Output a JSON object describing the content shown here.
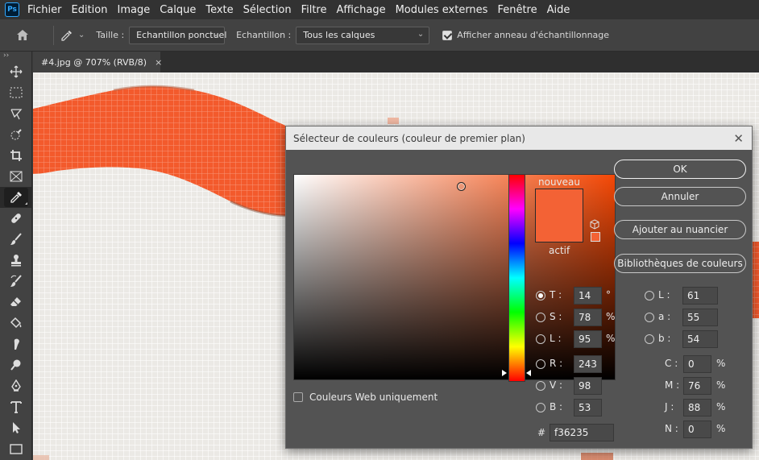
{
  "app": {
    "logo": "Ps"
  },
  "menu": [
    "Fichier",
    "Edition",
    "Image",
    "Calque",
    "Texte",
    "Sélection",
    "Filtre",
    "Affichage",
    "Modules externes",
    "Fenêtre",
    "Aide"
  ],
  "options": {
    "size_label": "Taille :",
    "size_value": "Echantillon ponctuel",
    "sample_label": "Echantillon :",
    "sample_value": "Tous les calques",
    "ring_label": "Afficher anneau d'échantillonnage",
    "ring_checked": true
  },
  "toolbar": {
    "collapse": "››",
    "tools": [
      "move-icon",
      "marquee-icon",
      "lasso-icon",
      "quick-select-icon",
      "crop-icon",
      "frame-icon",
      "eyedropper-icon",
      "healing-icon",
      "brush-icon",
      "stamp-icon",
      "history-brush-icon",
      "eraser-icon",
      "paint-bucket-icon",
      "smudge-icon",
      "dodge-icon",
      "pen-icon",
      "type-icon",
      "path-select-icon",
      "rectangle-icon"
    ],
    "active": "eyedropper-icon"
  },
  "document": {
    "tab_title": "#4.jpg @ 707% (RVB/8)",
    "close": "×"
  },
  "dialog": {
    "title": "Sélecteur de couleurs (couleur de premier plan)",
    "close": "✕",
    "new_label": "nouveau",
    "current_label": "actif",
    "new_color": "#f36235",
    "current_color": "#f36235",
    "web_only_label": "Couleurs Web uniquement",
    "buttons": {
      "ok": "OK",
      "cancel": "Annuler",
      "add_swatch": "Ajouter au nuancier",
      "libraries": "Bibliothèques de couleurs"
    },
    "hsb": [
      {
        "label": "T :",
        "value": "14",
        "unit": "°",
        "selected": true
      },
      {
        "label": "S :",
        "value": "78",
        "unit": "%",
        "selected": false
      },
      {
        "label": "L :",
        "value": "95",
        "unit": "%",
        "selected": false
      }
    ],
    "rgb": [
      {
        "label": "R :",
        "value": "243"
      },
      {
        "label": "V :",
        "value": "98"
      },
      {
        "label": "B :",
        "value": "53"
      }
    ],
    "lab": [
      {
        "label": "L :",
        "value": "61"
      },
      {
        "label": "a :",
        "value": "55"
      },
      {
        "label": "b :",
        "value": "54"
      }
    ],
    "cmyk": [
      {
        "label": "C :",
        "value": "0",
        "unit": "%"
      },
      {
        "label": "M :",
        "value": "76",
        "unit": "%"
      },
      {
        "label": "J :",
        "value": "88",
        "unit": "%"
      },
      {
        "label": "N :",
        "value": "0",
        "unit": "%"
      }
    ],
    "hex_label": "#",
    "hex_value": "f36235"
  }
}
